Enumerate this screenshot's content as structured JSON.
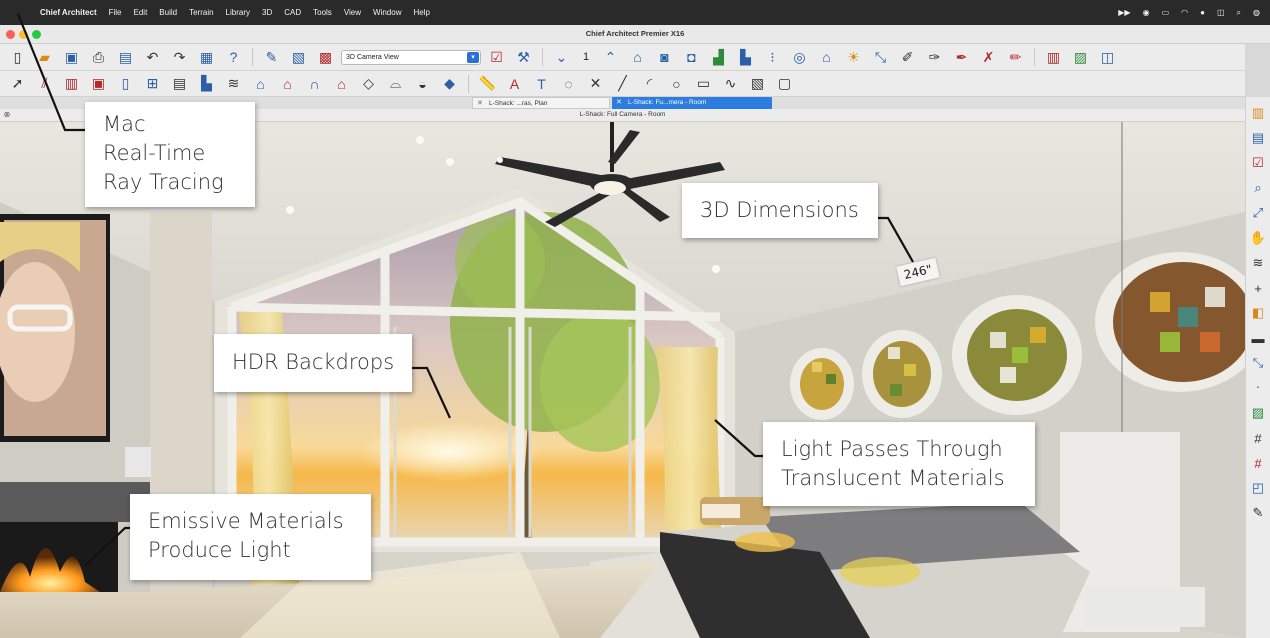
{
  "menubar": {
    "app": "Chief Architect",
    "items": [
      "File",
      "Edit",
      "Build",
      "Terrain",
      "Library",
      "3D",
      "CAD",
      "Tools",
      "View",
      "Window",
      "Help"
    ]
  },
  "window": {
    "title": "Chief Architect Premier X16"
  },
  "toolbar": {
    "view_select": "3D Camera View",
    "floor": "1"
  },
  "tabs": [
    {
      "label": "L-Shack: ...ras, Plan"
    },
    {
      "label": "L-Shack: Fu...mera - Room"
    }
  ],
  "view_title": "L-Shack: Full Camera - Room",
  "callouts": {
    "mac": [
      "Mac",
      "Real-Time",
      "Ray Tracing"
    ],
    "dimensions": [
      "3D Dimensions"
    ],
    "hdr": [
      "HDR Backdrops"
    ],
    "light": [
      "Light Passes Through",
      "Translucent Materials"
    ],
    "emissive": [
      "Emissive Materials",
      "Produce Light"
    ]
  },
  "dimension_label": "246\"",
  "colors": {
    "tab_active": "#2d7de0",
    "menubar": "#2a2a2a",
    "accent_blue": "#2b5fa8"
  }
}
